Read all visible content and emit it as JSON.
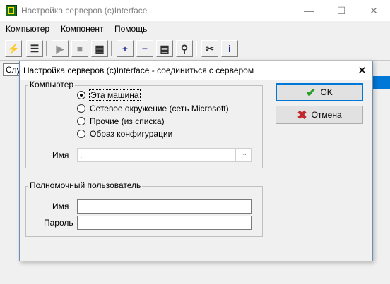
{
  "app": {
    "title": "Настройка серверов (c)Interface",
    "window_controls": {
      "minimize": "—",
      "maximize": "☐",
      "close": "✕"
    }
  },
  "menu": {
    "items": [
      {
        "label": "Компьютер"
      },
      {
        "label": "Компонент"
      },
      {
        "label": "Помощь"
      }
    ]
  },
  "toolbar": {
    "buttons": [
      {
        "icon": "lightning-connect-icon",
        "glyph": "⚡",
        "color": "#c8a000"
      },
      {
        "icon": "document-list-icon",
        "glyph": "☰",
        "color": "#303030"
      },
      {
        "icon": "play-icon",
        "glyph": "▶",
        "color": "#909090"
      },
      {
        "icon": "stop-icon",
        "glyph": "■",
        "color": "#909090"
      },
      {
        "icon": "grid-select-icon",
        "glyph": "▦",
        "color": "#303030"
      },
      {
        "icon": "add-icon",
        "glyph": "+",
        "color": "#1c2b8f"
      },
      {
        "icon": "remove-icon",
        "glyph": "−",
        "color": "#1c2b8f"
      },
      {
        "icon": "properties-icon",
        "glyph": "▤",
        "color": "#303030"
      },
      {
        "icon": "search-icon",
        "glyph": "⚲",
        "color": "#303030"
      },
      {
        "icon": "tools-icon",
        "glyph": "✂",
        "color": "#303030"
      },
      {
        "icon": "info-icon",
        "glyph": "i",
        "color": "#1c2b8f"
      }
    ]
  },
  "background": {
    "list_header": "Слу"
  },
  "dialog": {
    "title": "Настройка серверов (c)Interface - соединиться с сервером",
    "close_glyph": "✕",
    "computer_group": {
      "legend": "Компьютер",
      "options": [
        {
          "label": "Эта машина",
          "checked": true
        },
        {
          "label": "Сетевое окружение (сеть Microsoft)",
          "checked": false
        },
        {
          "label": "Прочие  (из списка)",
          "checked": false
        },
        {
          "label": "Образ конфигурации",
          "checked": false
        }
      ],
      "name_label": "Имя",
      "name_value": ".",
      "browse_label": "···"
    },
    "user_group": {
      "legend": "Полномочный пользователь",
      "name_label": "Имя",
      "name_value": "",
      "password_label": "Пароль",
      "password_value": ""
    },
    "buttons": {
      "ok_label": "OK",
      "ok_icon": "checkmark-icon",
      "ok_color": "#2a9d2a",
      "cancel_label": "Отмена",
      "cancel_icon": "cross-icon",
      "cancel_color": "#c0282d"
    }
  }
}
